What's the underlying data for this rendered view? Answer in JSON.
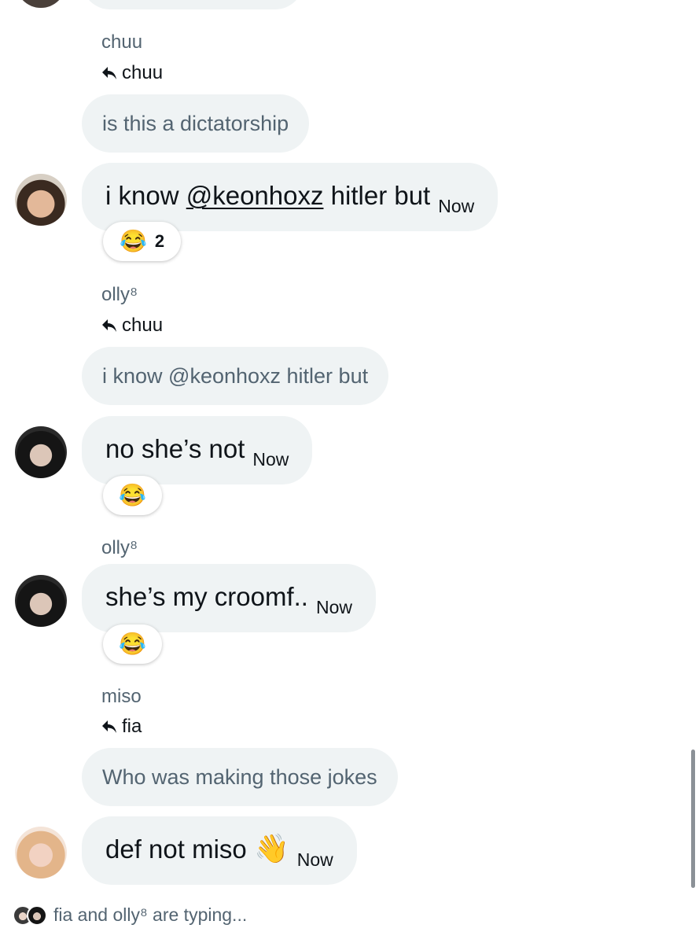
{
  "colors": {
    "bubble": "#eff3f4",
    "muted": "#536471",
    "text": "#0f1419"
  },
  "messages": [
    {
      "sender": "chuu",
      "reply_to": "chuu",
      "quoted": "is this a dictatorship",
      "text_before": "i know ",
      "mention": "@keonhoxz",
      "text_after": " hitler but",
      "time": "Now",
      "reaction": {
        "emoji": "😂",
        "count": "2"
      }
    },
    {
      "sender": "olly⁸",
      "reply_to": "chuu",
      "quoted": "i know @keonhoxz hitler but",
      "text": "no she’s not",
      "time": "Now",
      "reaction": {
        "emoji": "😂"
      }
    },
    {
      "sender": "olly⁸",
      "text": "she’s my croomf..",
      "time": "Now",
      "reaction": {
        "emoji": "😂"
      }
    },
    {
      "sender": "miso",
      "reply_to": "fia",
      "quoted": "Who was making those jokes",
      "text": "def not miso",
      "emoji": "👋",
      "time": "Now"
    }
  ],
  "typing_indicator": "fia and olly⁸ are typing..."
}
